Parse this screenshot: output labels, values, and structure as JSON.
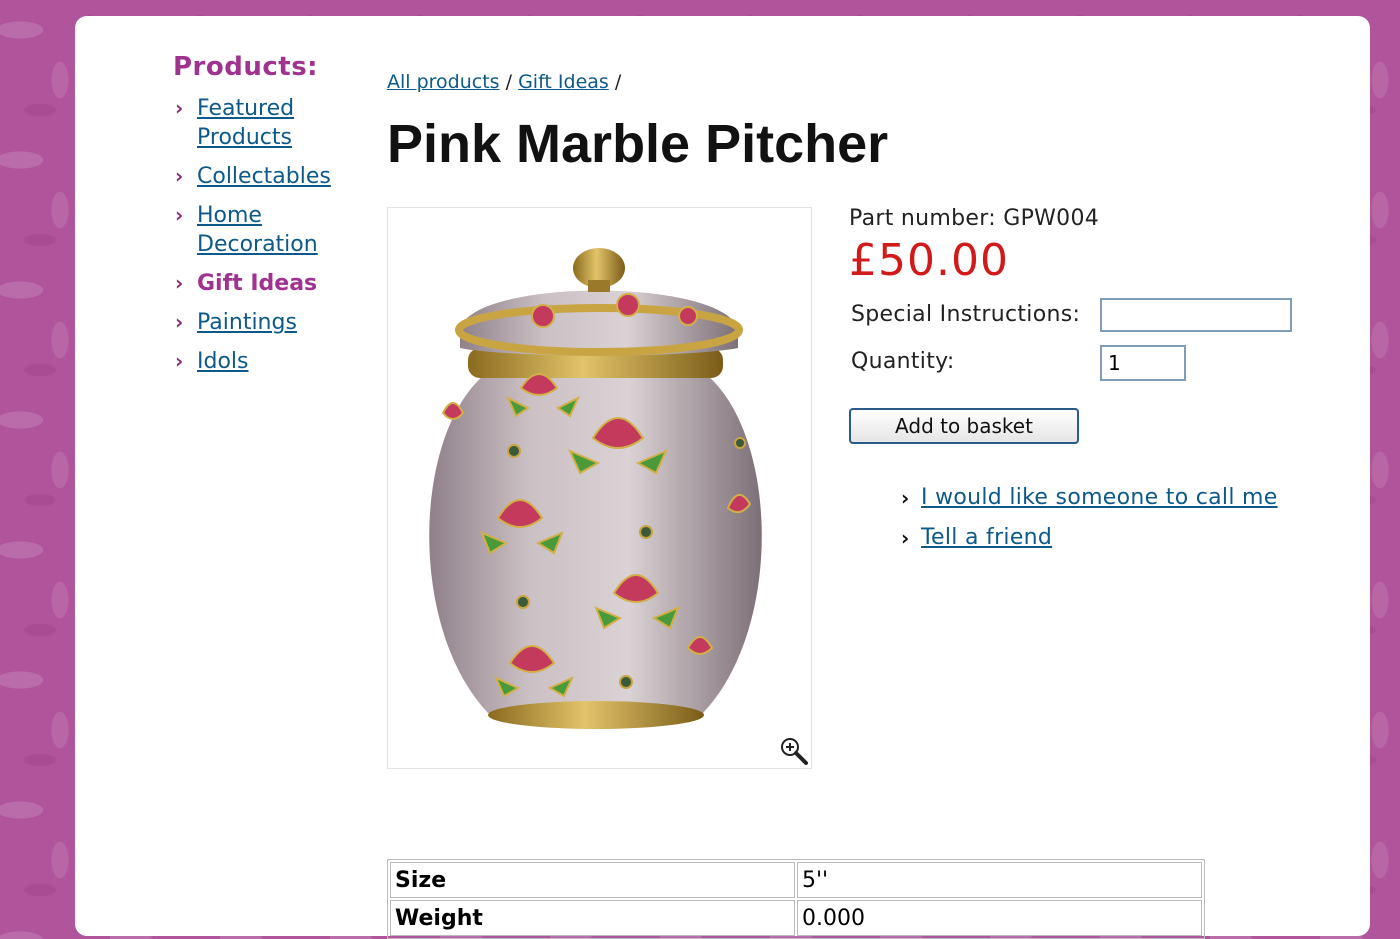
{
  "sidebar": {
    "heading": "Products:",
    "items": [
      {
        "label": "Featured Products",
        "active": false
      },
      {
        "label": "Collectables",
        "active": false
      },
      {
        "label": "Home Decoration",
        "active": false
      },
      {
        "label": "Gift Ideas",
        "active": true
      },
      {
        "label": "Paintings",
        "active": false
      },
      {
        "label": "Idols",
        "active": false
      }
    ]
  },
  "breadcrumb": {
    "items": [
      "All products",
      "Gift Ideas"
    ],
    "separator": "/"
  },
  "product": {
    "title": "Pink Marble Pitcher",
    "part_label": "Part number:",
    "part_number": "GPW004",
    "price": "£50.00",
    "special_instructions_label": "Special Instructions:",
    "special_instructions_value": "",
    "quantity_label": "Quantity:",
    "quantity_value": "1",
    "add_button": "Add to basket",
    "links": [
      "I would like someone to call me",
      "Tell a friend"
    ]
  },
  "specs": [
    {
      "key": "Size",
      "value": "5''"
    },
    {
      "key": "Weight",
      "value": "0.000"
    }
  ],
  "colors": {
    "accent_purple": "#a0338f",
    "link_blue": "#0d5a8a",
    "price_red": "#d11a1a",
    "background": "#b0559c"
  },
  "icons": [
    "chevron-right-icon",
    "zoom-in-icon"
  ]
}
